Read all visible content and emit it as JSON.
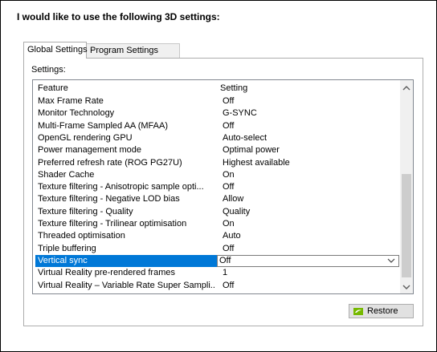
{
  "heading": "I would like to use the following 3D settings:",
  "tabs": [
    {
      "label": "Global Settings",
      "active": true
    },
    {
      "label": "Program Settings",
      "active": false
    }
  ],
  "settings_label": "Settings:",
  "list": {
    "headers": {
      "feature": "Feature",
      "setting": "Setting"
    },
    "rows": [
      {
        "feature": "Max Frame Rate",
        "setting": "Off"
      },
      {
        "feature": "Monitor Technology",
        "setting": "G-SYNC"
      },
      {
        "feature": "Multi-Frame Sampled AA (MFAA)",
        "setting": "Off"
      },
      {
        "feature": "OpenGL rendering GPU",
        "setting": "Auto-select"
      },
      {
        "feature": "Power management mode",
        "setting": "Optimal power"
      },
      {
        "feature": "Preferred refresh rate (ROG PG27U)",
        "setting": "Highest available"
      },
      {
        "feature": "Shader Cache",
        "setting": "On"
      },
      {
        "feature": "Texture filtering - Anisotropic sample opti...",
        "setting": "Off"
      },
      {
        "feature": "Texture filtering - Negative LOD bias",
        "setting": "Allow"
      },
      {
        "feature": "Texture filtering - Quality",
        "setting": "Quality"
      },
      {
        "feature": "Texture filtering - Trilinear optimisation",
        "setting": "On"
      },
      {
        "feature": "Threaded optimisation",
        "setting": "Auto"
      },
      {
        "feature": "Triple buffering",
        "setting": "Off"
      },
      {
        "feature": "Vertical sync",
        "setting": "Off",
        "selected": true
      },
      {
        "feature": "Virtual Reality pre-rendered frames",
        "setting": "1"
      },
      {
        "feature": "Virtual Reality – Variable Rate Super Sampli...",
        "setting": "Off"
      }
    ]
  },
  "scrollbar": {
    "up_icon": "chevron-up-icon",
    "down_icon": "chevron-down-icon",
    "position_fraction": 0.72
  },
  "restore_button": {
    "label": "Restore",
    "icon": "nvidia-logo-icon",
    "accent": "#76b900"
  },
  "colors": {
    "selection": "#0078d7"
  }
}
